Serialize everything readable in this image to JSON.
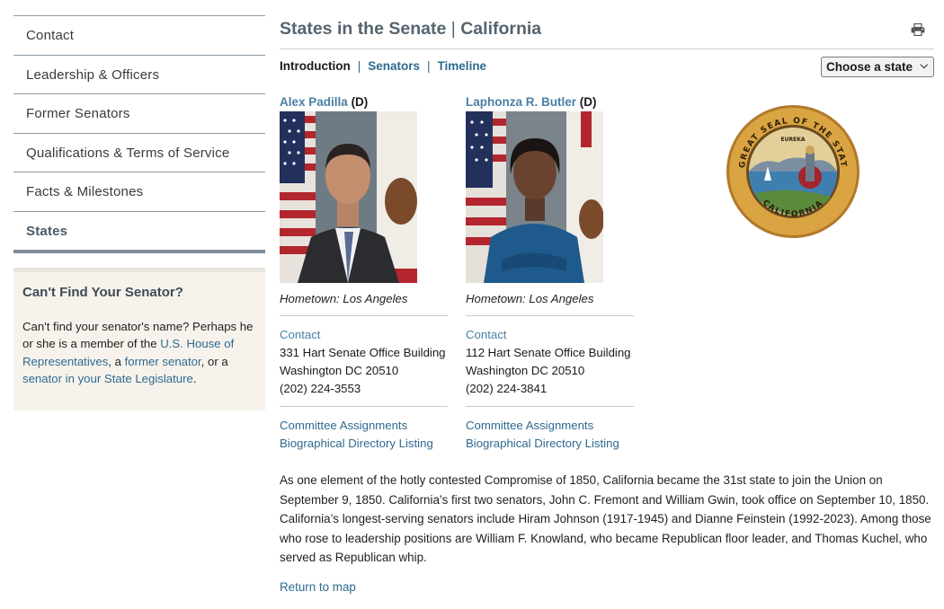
{
  "sidebar": {
    "items": [
      {
        "label": "Contact"
      },
      {
        "label": "Leadership & Officers"
      },
      {
        "label": "Former Senators"
      },
      {
        "label": "Qualifications & Terms of Service"
      },
      {
        "label": "Facts & Milestones"
      },
      {
        "label": "States"
      }
    ],
    "find": {
      "title": "Can't Find Your Senator?",
      "text_1": "Can't find your senator's name? Perhaps he or she is a member of the ",
      "link_house": "U.S. House of Representatives",
      "text_2": ", a ",
      "link_former": "former senator",
      "text_3": ", or a ",
      "link_state": "senator in your State Legislature",
      "text_4": "."
    }
  },
  "header": {
    "title_prefix": "States in the Senate",
    "title_sep": " | ",
    "title_state": "California",
    "print_icon": "print-icon"
  },
  "subnav": {
    "introduction": "Introduction",
    "senators": "Senators",
    "timeline": "Timeline",
    "divider": "|",
    "select_value": "Choose a state"
  },
  "senators": [
    {
      "name": "Alex Padilla",
      "party": "(D)",
      "hometown": "Hometown: Los Angeles",
      "contact_label": "Contact",
      "office": "331 Hart Senate Office Building",
      "city": "Washington DC 20510",
      "phone": "(202) 224-3553",
      "committee_link": "Committee Assignments",
      "bio_link": "Biographical Directory Listing"
    },
    {
      "name": "Laphonza R. Butler",
      "party": "(D)",
      "hometown": "Hometown: Los Angeles",
      "contact_label": "Contact",
      "office": "112 Hart Senate Office Building",
      "city": "Washington DC 20510",
      "phone": "(202) 224-3841",
      "committee_link": "Committee Assignments",
      "bio_link": "Biographical Directory Listing"
    }
  ],
  "seal": {
    "top_text": "THE GREAT SEAL OF THE STATE OF",
    "bottom_text": "CALIFORNIA",
    "motto": "EUREKA"
  },
  "bio": "As one element of the hotly contested Compromise of 1850, California became the 31st state to join the Union on September 9, 1850. California’s first two senators, John C. Fremont and William Gwin, took office on September 10, 1850. California’s longest-serving senators include Hiram Johnson (1917-1945) and Dianne Feinstein (1992-2023). Among those who rose to leadership positions are William F. Knowland, who became Republican floor leader, and Thomas Kuchel, who served as Republican whip.",
  "return_link": "Return to map",
  "colors": {
    "link": "#2e6a8f",
    "title": "#56646f",
    "sidebar_bg": "#f7f3ec"
  }
}
